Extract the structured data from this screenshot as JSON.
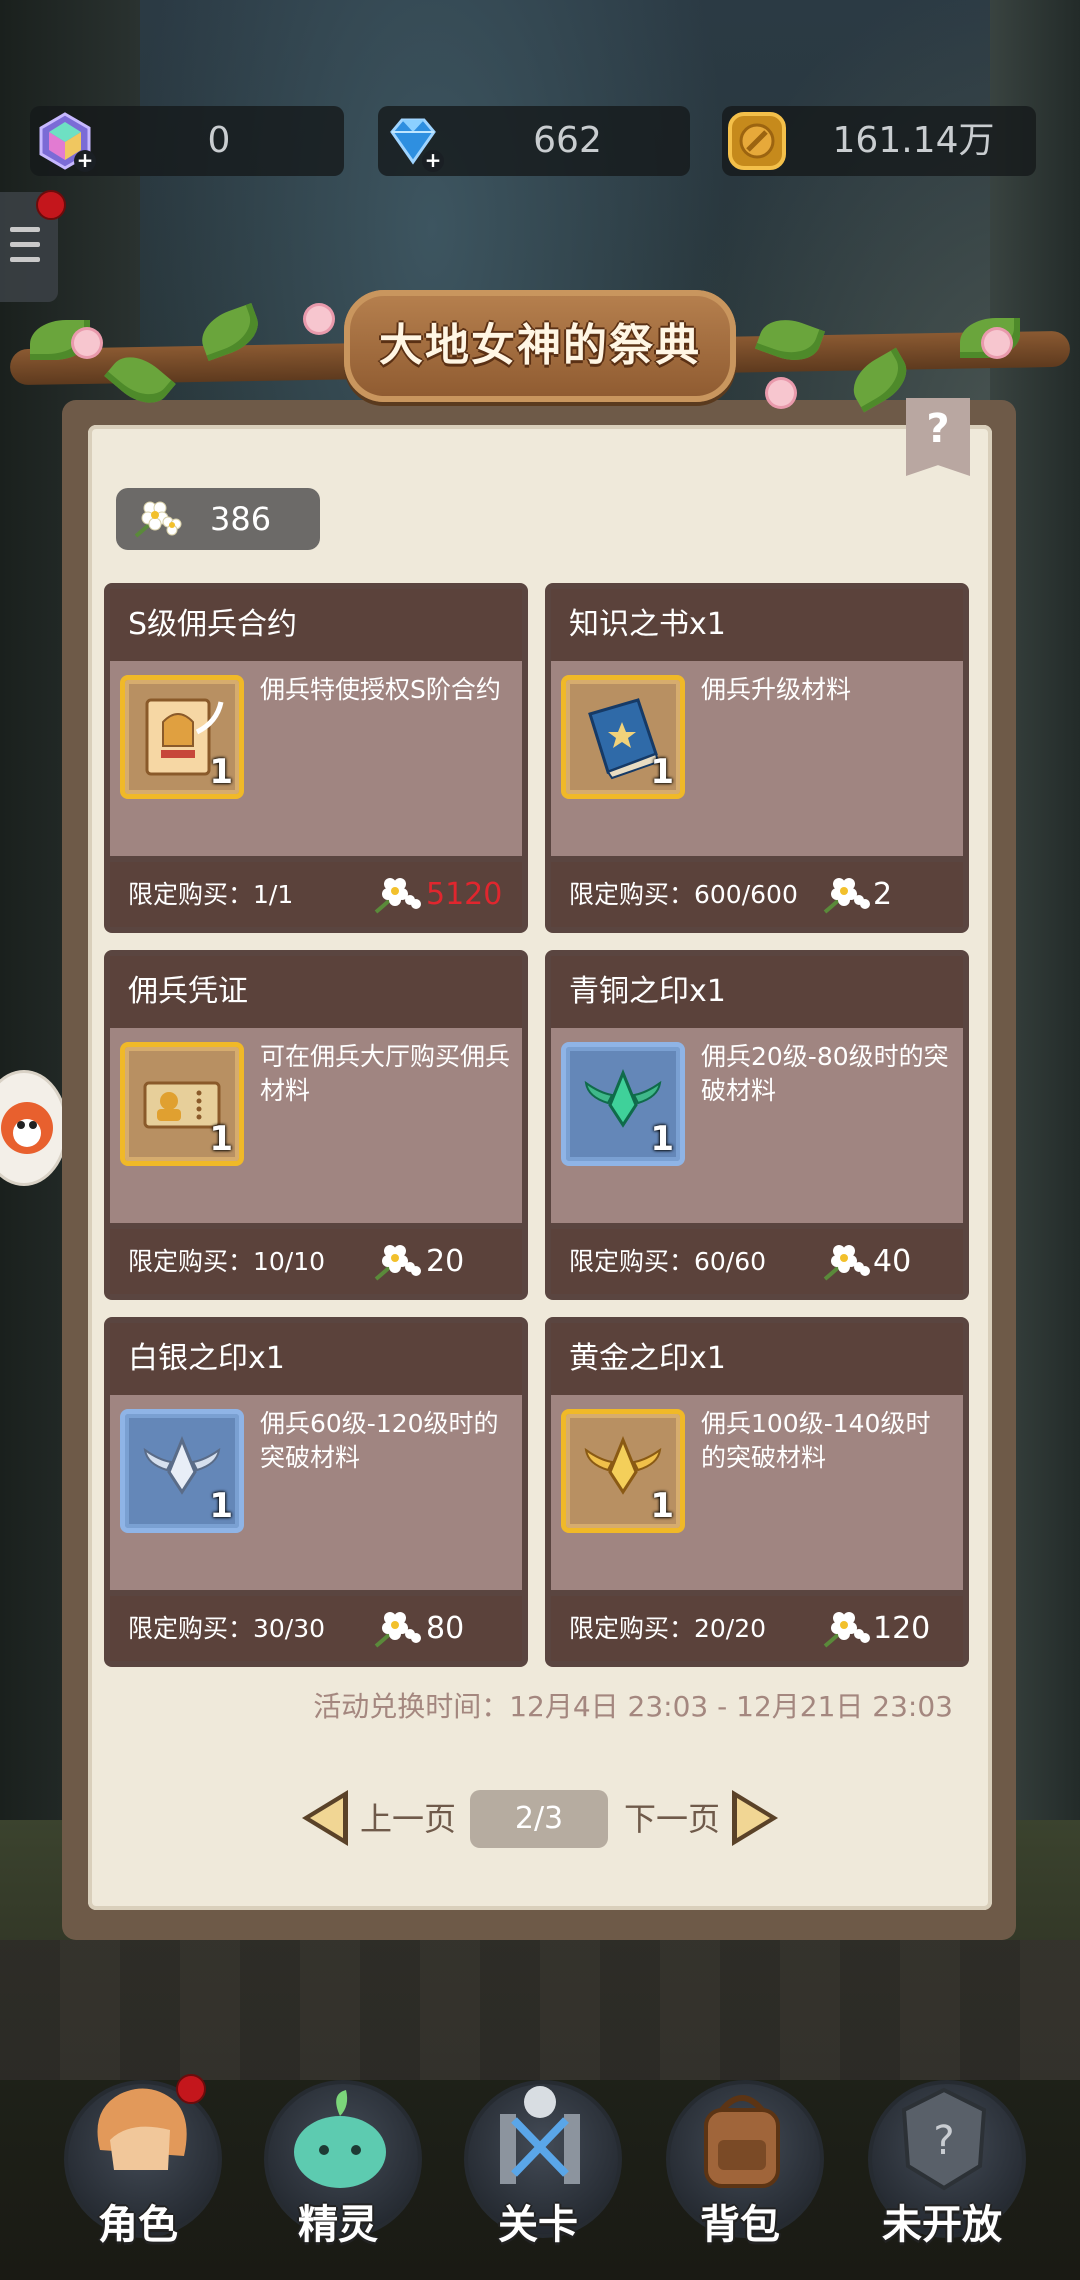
{
  "currencies": [
    {
      "name": "rainbow-gem",
      "value": "0"
    },
    {
      "name": "blue-diamond",
      "value": "662"
    },
    {
      "name": "gold-coin",
      "value": "161.14万"
    }
  ],
  "event": {
    "title": "大地女神的祭典",
    "help_label": "?",
    "flower_balance": "386",
    "exchange_time": "活动兑换时间：12月4日 23:03 - 12月21日 23:03"
  },
  "cards": [
    {
      "title": "S级佣兵合约",
      "desc": "佣兵特使授权S阶合约",
      "qty": "1",
      "limit": "限定购买：1/1",
      "price": "5120",
      "price_color": "#e0262e",
      "icon": "contract-icon"
    },
    {
      "title": "知识之书x1",
      "desc": "佣兵升级材料",
      "qty": "1",
      "limit": "限定购买：600/600",
      "price": "2",
      "icon": "book-icon"
    },
    {
      "title": "佣兵凭证",
      "desc": "可在佣兵大厅购买佣兵材料",
      "qty": "1",
      "limit": "限定购买：10/10",
      "price": "20",
      "icon": "voucher-icon"
    },
    {
      "title": "青铜之印x1",
      "desc": "佣兵20级-80级时的突破材料",
      "qty": "1",
      "limit": "限定购买：60/60",
      "price": "40",
      "icon": "bronze-seal-icon"
    },
    {
      "title": "白银之印x1",
      "desc": "佣兵60级-120级时的突破材料",
      "qty": "1",
      "limit": "限定购买：30/30",
      "price": "80",
      "icon": "silver-seal-icon"
    },
    {
      "title": "黄金之印x1",
      "desc": "佣兵100级-140级时的突破材料",
      "qty": "1",
      "limit": "限定购买：20/20",
      "price": "120",
      "icon": "gold-seal-icon"
    }
  ],
  "pager": {
    "prev": "上一页",
    "page": "2/3",
    "next": "下一页"
  },
  "nav": [
    {
      "label": "角色",
      "icon": "character-icon",
      "badge": true
    },
    {
      "label": "精灵",
      "icon": "spirit-icon",
      "badge": false
    },
    {
      "label": "关卡",
      "icon": "stage-icon",
      "badge": false
    },
    {
      "label": "背包",
      "icon": "backpack-icon",
      "badge": false
    },
    {
      "label": "未开放",
      "icon": "locked-icon",
      "badge": false
    }
  ]
}
